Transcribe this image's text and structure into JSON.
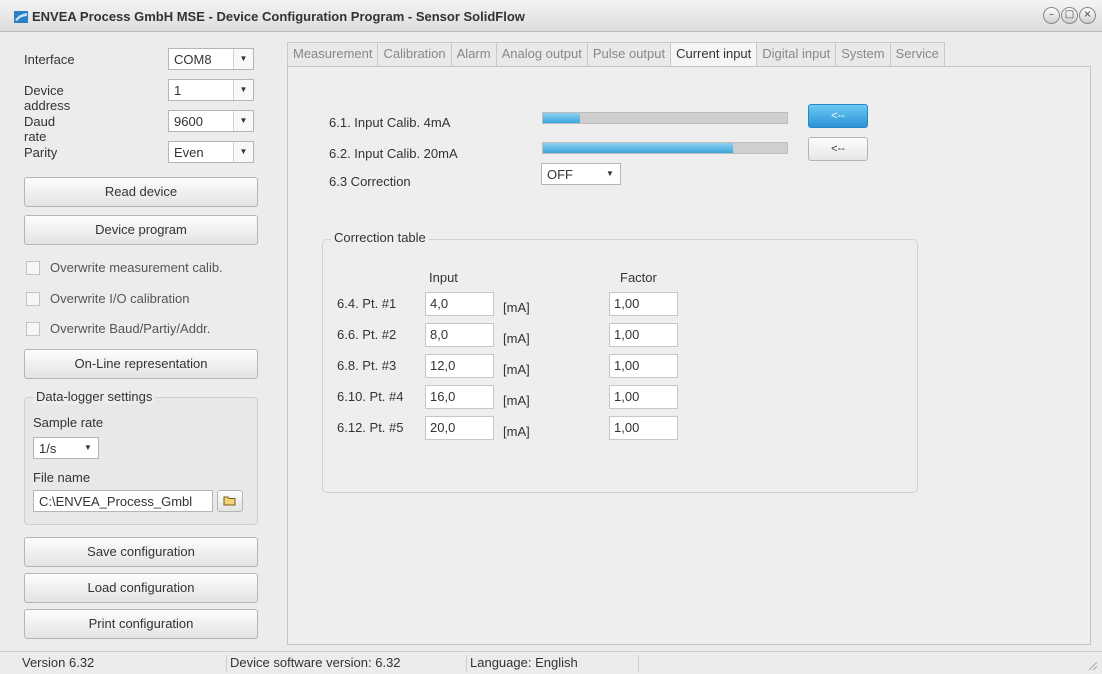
{
  "window": {
    "title": "ENVEA Process GmbH MSE - Device Configuration Program - Sensor SolidFlow",
    "btn_minimize": "–",
    "btn_maximize": "□",
    "btn_close": "×"
  },
  "left": {
    "params": [
      {
        "label": "Interface",
        "value": "COM8"
      },
      {
        "label": "Device address",
        "value": "1"
      },
      {
        "label": "Daud rate",
        "value": "9600"
      },
      {
        "label": "Parity",
        "value": "Even"
      }
    ],
    "read_device": "Read device",
    "device_program": "Device program",
    "checkboxes": [
      "Overwrite measurement calib.",
      "Overwrite I/O calibration",
      "Overwrite Baud/Partiy/Addr."
    ],
    "online": "On-Line representation",
    "datalogger": {
      "title": "Data-logger settings",
      "sample_rate_label": "Sample rate",
      "sample_rate_value": "1/s",
      "file_name_label": "File name",
      "file_name_value": "C:\\ENVEA_Process_Gmbl"
    },
    "save": "Save configuration",
    "load": "Load configuration",
    "print": "Print configuration"
  },
  "tabs": [
    "Measurement",
    "Calibration",
    "Alarm",
    "Analog output",
    "Pulse output",
    "Current input",
    "Digital input",
    "System",
    "Service"
  ],
  "active_tab": "Current input",
  "current_input": {
    "calib_4": {
      "label": "6.1. Input Calib. 4mA",
      "level": 0.15,
      "button": "<--"
    },
    "calib_20": {
      "label": "6.2. Input Calib. 20mA",
      "level": 0.78,
      "button": "<--"
    },
    "correction": {
      "label": "6.3 Correction",
      "value": "OFF"
    },
    "table": {
      "title": "Correction table",
      "col_input": "Input",
      "col_factor": "Factor",
      "unit": "[mA]",
      "rows": [
        {
          "label": "6.4. Pt. #1",
          "input": "4,0",
          "factor": "1,00"
        },
        {
          "label": "6.6. Pt. #2",
          "input": "8,0",
          "factor": "1,00"
        },
        {
          "label": "6.8. Pt. #3",
          "input": "12,0",
          "factor": "1,00"
        },
        {
          "label": "6.10. Pt. #4",
          "input": "16,0",
          "factor": "1,00"
        },
        {
          "label": "6.12. Pt. #5",
          "input": "20,0",
          "factor": "1,00"
        }
      ]
    }
  },
  "status": {
    "version": "Version 6.32",
    "device_sw": "Device software version: 6.32",
    "language": "Language: English"
  },
  "colors": {
    "accent": "#3aa6dd",
    "primary_button": "#2a94d6"
  }
}
